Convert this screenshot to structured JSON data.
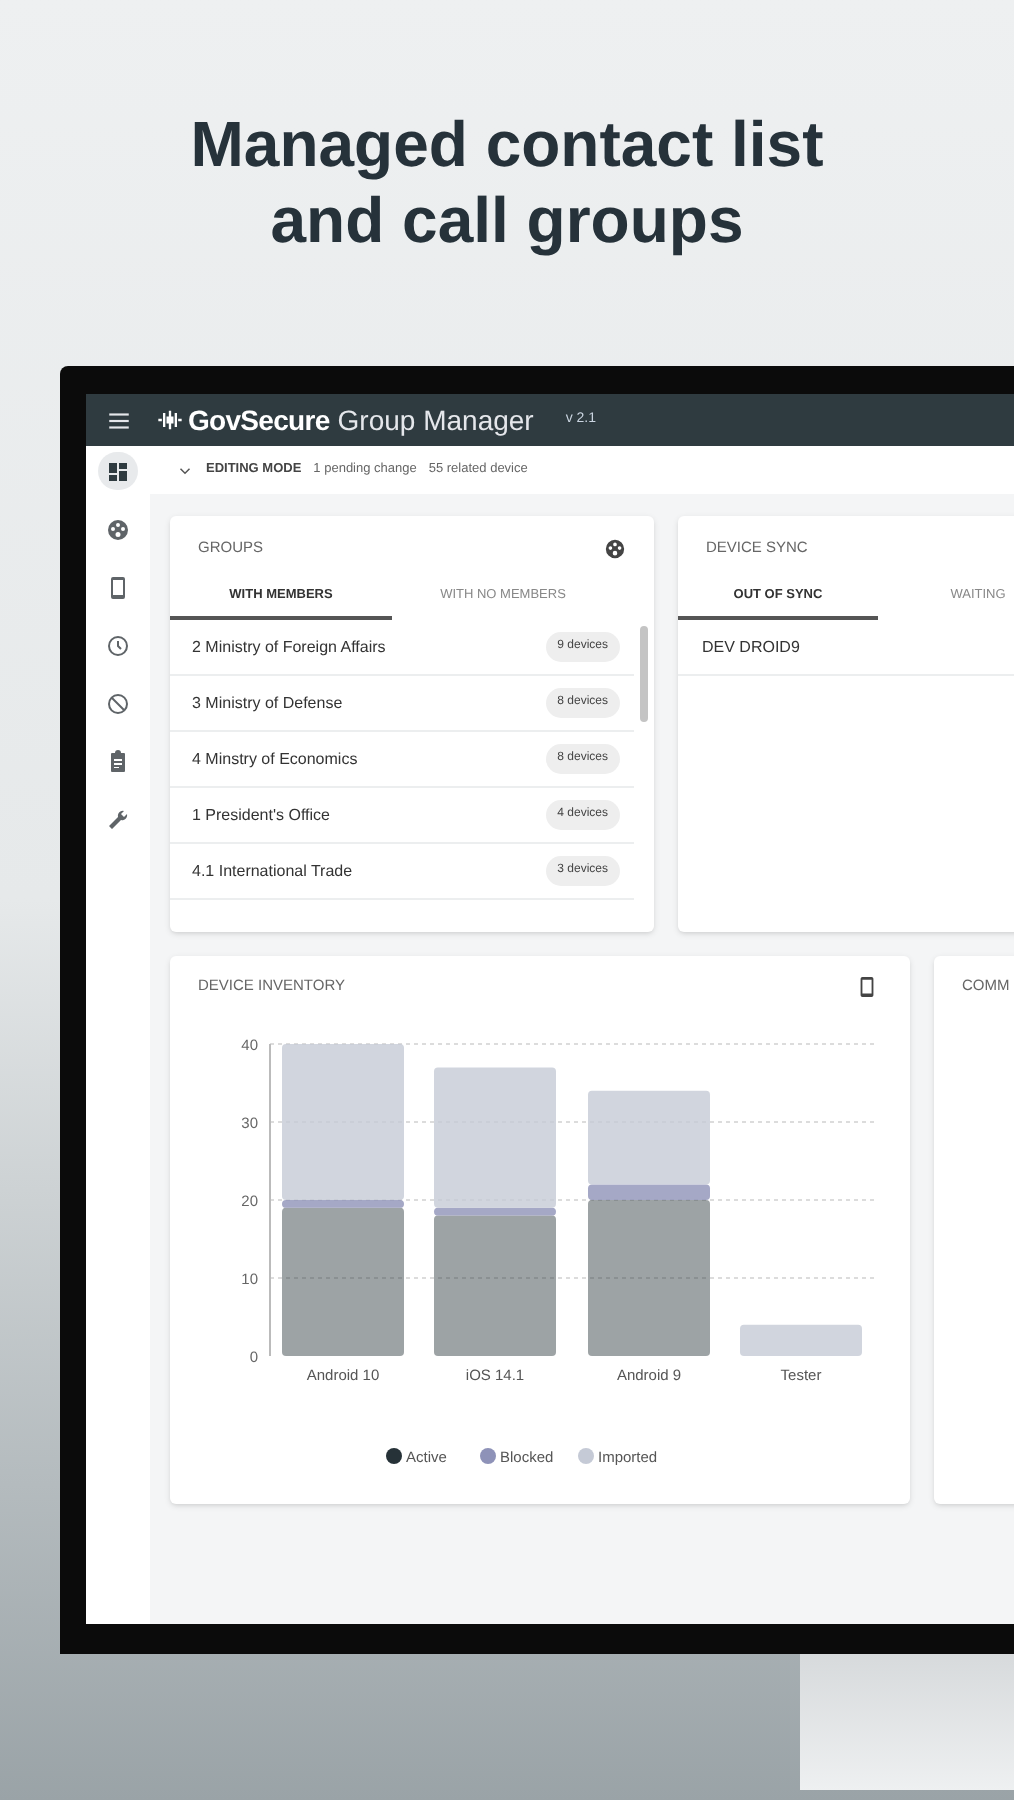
{
  "headline": [
    "Managed contact list",
    "and call groups"
  ],
  "app": {
    "brand": "GovSecure",
    "title": "Group Manager",
    "version": "v 2.1"
  },
  "sidebar": {
    "items": [
      {
        "kind": "dashboard",
        "selected": true
      },
      {
        "kind": "palette",
        "selected": false
      },
      {
        "kind": "phone",
        "selected": false
      },
      {
        "kind": "clock",
        "selected": false
      },
      {
        "kind": "block",
        "selected": false
      },
      {
        "kind": "clipboard",
        "selected": false
      },
      {
        "kind": "wrench",
        "selected": false
      }
    ]
  },
  "editing_bar": {
    "mode": "EDITING MODE",
    "pending": "1 pending change",
    "related": "55 related device"
  },
  "groups": {
    "title": "GROUPS",
    "tabs": [
      {
        "label": "WITH MEMBERS",
        "selected": true
      },
      {
        "label": "WITH NO MEMBERS",
        "selected": false
      }
    ],
    "rows": [
      {
        "name": "2 Ministry of Foreign Affairs",
        "count": "9 devices"
      },
      {
        "name": "3 Ministry of Defense",
        "count": "8 devices"
      },
      {
        "name": "4 Minstry of Economics",
        "count": "8 devices"
      },
      {
        "name": "1 President's Office",
        "count": "4 devices"
      },
      {
        "name": "4.1 International Trade",
        "count": "3 devices"
      }
    ]
  },
  "device_sync": {
    "title": "DEVICE SYNC",
    "tabs": [
      {
        "label": "OUT OF SYNC",
        "selected": true
      },
      {
        "label": "WAITING",
        "selected": false
      }
    ],
    "rows": [
      "DEV DROID9"
    ]
  },
  "inventory": {
    "title": "DEVICE INVENTORY",
    "chart_data": {
      "type": "bar",
      "stacked": true,
      "categories": [
        "Android 10",
        "iOS 14.1",
        "Android 9",
        "Tester"
      ],
      "yticks": [
        0,
        10,
        20,
        30,
        40
      ],
      "ylim": [
        0,
        40
      ],
      "grid": true,
      "legend": true,
      "series": [
        {
          "name": "Active",
          "color": "#263238",
          "values": [
            19,
            18,
            20,
            0
          ]
        },
        {
          "name": "Blocked",
          "color": "#8e92b8",
          "values": [
            1,
            1,
            2,
            0
          ]
        },
        {
          "name": "Imported",
          "color": "#c5cad6",
          "values": [
            20,
            18,
            12,
            4
          ]
        }
      ]
    }
  },
  "comm": {
    "title": "COMM"
  }
}
